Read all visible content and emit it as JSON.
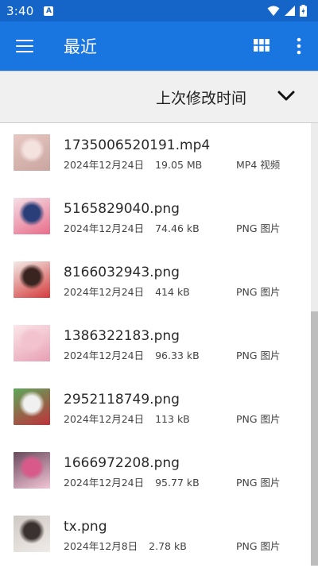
{
  "status_bar": {
    "time": "3:40",
    "notification_icon": "A",
    "icons": [
      "wifi-icon",
      "signal-icon",
      "battery-icon"
    ]
  },
  "app_bar": {
    "title": "最近",
    "menu_icon": "hamburger-menu-icon",
    "view_icon": "grid-view-icon",
    "more_icon": "more-vert-icon"
  },
  "sort": {
    "label": "上次修改时间",
    "icon": "chevron-down-icon"
  },
  "files": [
    {
      "name": "1735006520191.mp4",
      "date": "2024年12月24日",
      "size": "19.05 MB",
      "type": "MP4 视频",
      "thumb_colors": [
        "#e8c8c2",
        "#f4e2de",
        "#c9a59f"
      ]
    },
    {
      "name": "5165829040.png",
      "date": "2024年12月24日",
      "size": "74.46 kB",
      "type": "PNG 图片",
      "thumb_colors": [
        "#f5dfe6",
        "#2a3f7a",
        "#e86c8a"
      ]
    },
    {
      "name": "8166032943.png",
      "date": "2024年12月24日",
      "size": "414 kB",
      "type": "PNG 图片",
      "thumb_colors": [
        "#f2ece8",
        "#3a2420",
        "#d43a3a"
      ]
    },
    {
      "name": "1386322183.png",
      "date": "2024年12月24日",
      "size": "96.33 kB",
      "type": "PNG 图片",
      "thumb_colors": [
        "#fbe6ea",
        "#f2c2cf",
        "#e8a0b4"
      ]
    },
    {
      "name": "2952118749.png",
      "date": "2024年12月24日",
      "size": "113 kB",
      "type": "PNG 图片",
      "thumb_colors": [
        "#5ca85a",
        "#f0f0f0",
        "#c0303a"
      ]
    },
    {
      "name": "1666972208.png",
      "date": "2024年12月24日",
      "size": "95.77 kB",
      "type": "PNG 图片",
      "thumb_colors": [
        "#6a4a5e",
        "#d85a8a",
        "#f3c6d6"
      ]
    },
    {
      "name": "tx.png",
      "date": "2024年12月8日",
      "size": "2.78 kB",
      "type": "PNG 图片",
      "thumb_colors": [
        "#cfc9c4",
        "#3a3230",
        "#efebe8"
      ]
    }
  ],
  "colors": {
    "status_bar": "#1565c8",
    "app_bar": "#1976e0",
    "sort_bar": "#f0f0f0"
  }
}
